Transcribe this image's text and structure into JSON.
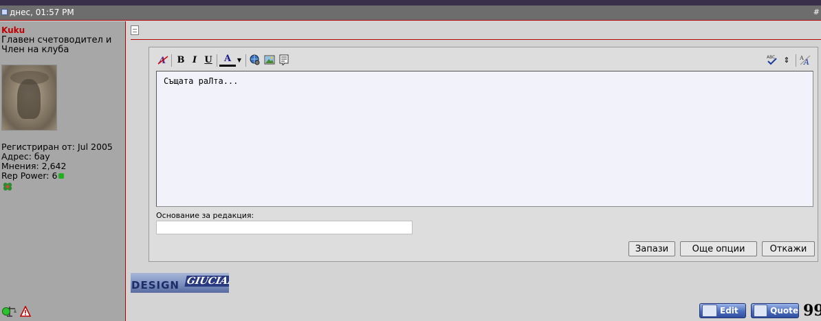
{
  "header": {
    "date": "днес, 01:57 PM",
    "post_number": "#"
  },
  "user": {
    "name": "Kuku",
    "title": "Главен счетоводител и Член на клуба",
    "registered": "Регистриран от: Jul 2005",
    "address": "Адрес: бау",
    "posts": "Мнения: 2,642",
    "rep_power": "Rep Power: 6",
    "rep_color": "#22b022",
    "status_color": "#2ec02e"
  },
  "editor": {
    "toolbar": [
      "remove-format-icon",
      "bold-icon",
      "italic-icon",
      "underline-icon",
      "font-color-icon",
      "insert-link-icon",
      "insert-image-icon",
      "quote-icon",
      "spell-check-icon",
      "resize-icon",
      "switch-mode-icon"
    ],
    "bold_label": "B",
    "italic_label": "I",
    "underline_label": "U",
    "font_color_label": "A",
    "content": "Същата раЛта...",
    "reason_label": "Основание за редакция:",
    "reason_value": "",
    "save_label": "Запази",
    "more_options_label": "Още опции",
    "cancel_label": "Откажи"
  },
  "signature": {
    "logo_text_1": "DESIGN",
    "logo_text_2": "GIUCIARD"
  },
  "post_actions": {
    "edit_label": "Edit",
    "quote_label": "Quote",
    "multiquote_label": "99"
  }
}
